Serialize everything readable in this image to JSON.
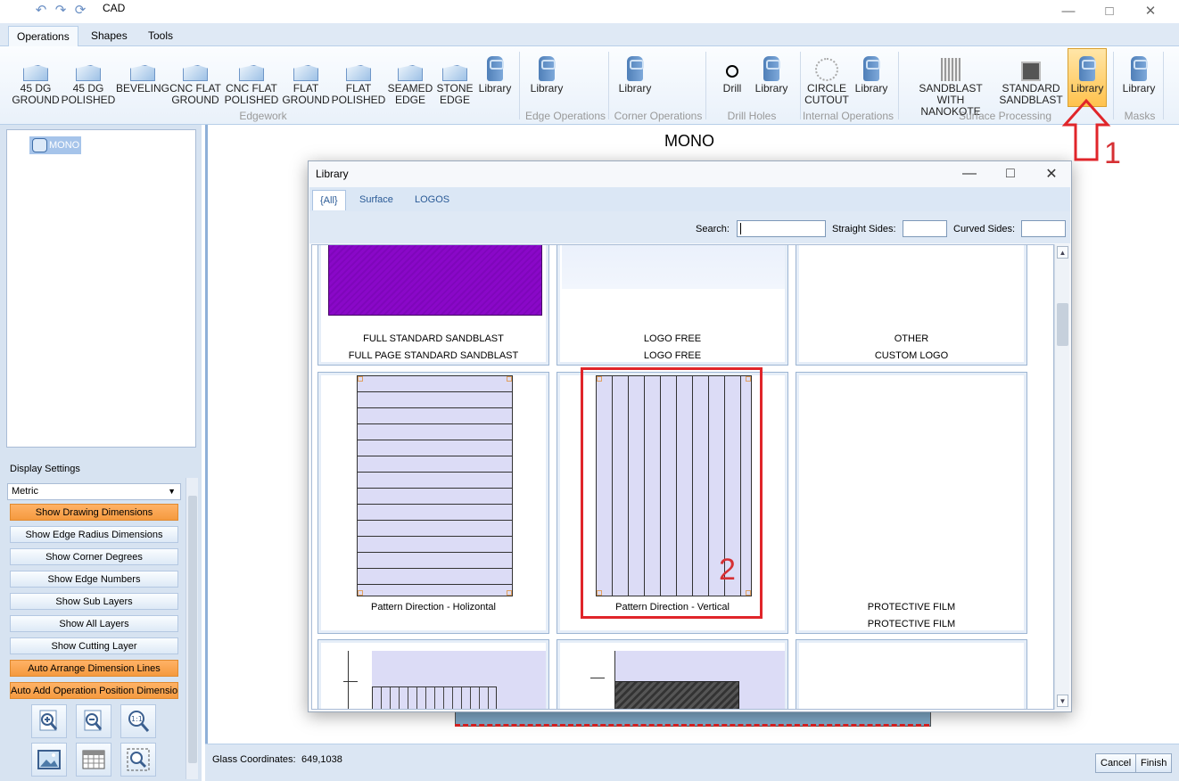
{
  "window": {
    "title": "CAD"
  },
  "ribbon": {
    "tabs": [
      "Operations",
      "Shapes",
      "Tools"
    ],
    "buttons": {
      "b45ground": [
        "45 DG",
        "GROUND"
      ],
      "b45polished": [
        "45 DG",
        "POLISHED"
      ],
      "beveling": [
        "BEVELING"
      ],
      "cncground": [
        "CNC FLAT",
        "GROUND"
      ],
      "cncpolished": [
        "CNC FLAT",
        "POLISHED"
      ],
      "flatground": [
        "FLAT",
        "GROUND"
      ],
      "flatpolished": [
        "FLAT",
        "POLISHED"
      ],
      "seamed": [
        "SEAMED",
        "EDGE"
      ],
      "stone": [
        "STONE",
        "EDGE"
      ],
      "library": "Library",
      "drill": "Drill",
      "circle": [
        "CIRCLE",
        "CUTOUT"
      ],
      "sandblastnano": [
        "SANDBLAST WITH",
        "NANOKOTE"
      ],
      "stdsandblast": [
        "STANDARD",
        "SANDBLAST"
      ]
    },
    "groups": {
      "edgework": "Edgework",
      "edgeops": "Edge Operations",
      "cornerops": "Corner Operations",
      "drillholes": "Drill Holes",
      "internalops": "Internal Operations",
      "surface": "Surface Processing",
      "masks": "Masks"
    }
  },
  "tree": {
    "node": "MONO"
  },
  "display": {
    "label": "Display Settings",
    "units": "Metric",
    "buttons": [
      "Show Drawing Dimensions",
      "Show Edge Radius Dimensions",
      "Show Corner Degrees",
      "Show Edge Numbers",
      "Show Sub Layers",
      "Show All Layers",
      "Show Cutting Layer",
      "Auto Arrange Dimension Lines",
      "Auto Add Operation Position Dimension"
    ],
    "active": [
      true,
      false,
      false,
      false,
      false,
      false,
      false,
      true,
      true
    ]
  },
  "canvas": {
    "title": "MONO"
  },
  "status": {
    "coord_label": "Glass Coordinates:",
    "coord_value": "649,1038",
    "cancel": "Cancel",
    "finish": "Finish"
  },
  "dialog": {
    "title": "Library",
    "tabs": [
      "{All}",
      "Surface",
      "LOGOS"
    ],
    "search_label": "Search:",
    "straight_label": "Straight Sides:",
    "curved_label": "Curved Sides:",
    "items": [
      {
        "line1": "FULL STANDARD SANDBLAST",
        "line2": "FULL PAGE STANDARD SANDBLAST"
      },
      {
        "line1": "LOGO FREE",
        "line2": "LOGO FREE"
      },
      {
        "line1": "OTHER",
        "line2": "CUSTOM LOGO"
      },
      {
        "line1": "Pattern Direction - Holizontal",
        "line2": ""
      },
      {
        "line1": "Pattern Direction - Vertical",
        "line2": ""
      },
      {
        "line1": "PROTECTIVE FILM",
        "line2": "PROTECTIVE FILM"
      }
    ]
  },
  "annotations": {
    "one": "1",
    "two": "2"
  },
  "colors": {
    "highlight_orange": "#f59a3f",
    "selected_library": "#ffc24d",
    "annotation_red": "#e0252a",
    "purple_fill": "#8a08c8"
  }
}
